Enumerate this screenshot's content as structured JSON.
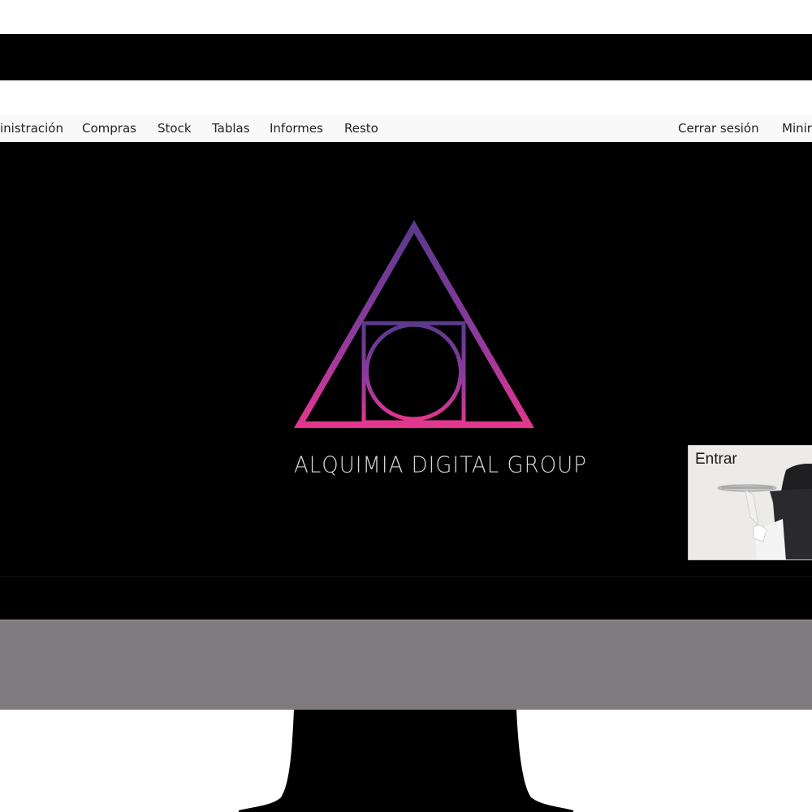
{
  "menu": {
    "left_items": [
      {
        "label": "inistración"
      },
      {
        "label": "Compras"
      },
      {
        "label": "Stock"
      },
      {
        "label": "Tablas"
      },
      {
        "label": "Informes"
      },
      {
        "label": "Resto"
      }
    ],
    "right_items": [
      {
        "label": "Cerrar sesión"
      },
      {
        "label": "Minir"
      }
    ]
  },
  "brand": {
    "name": "ALQUIMIA DIGITAL GROUP",
    "logo_icon": "triangle-circle-square-logo",
    "colors": {
      "gradient_top": "#5b3a8c",
      "gradient_bottom": "#e3368f"
    }
  },
  "enter_button": {
    "label": "Entrar",
    "icon": "waiter-tray-image"
  },
  "colors": {
    "screen_background": "#000000",
    "monitor_chin": "#7f7a7d",
    "menubar_background": "#f9f9f9"
  }
}
